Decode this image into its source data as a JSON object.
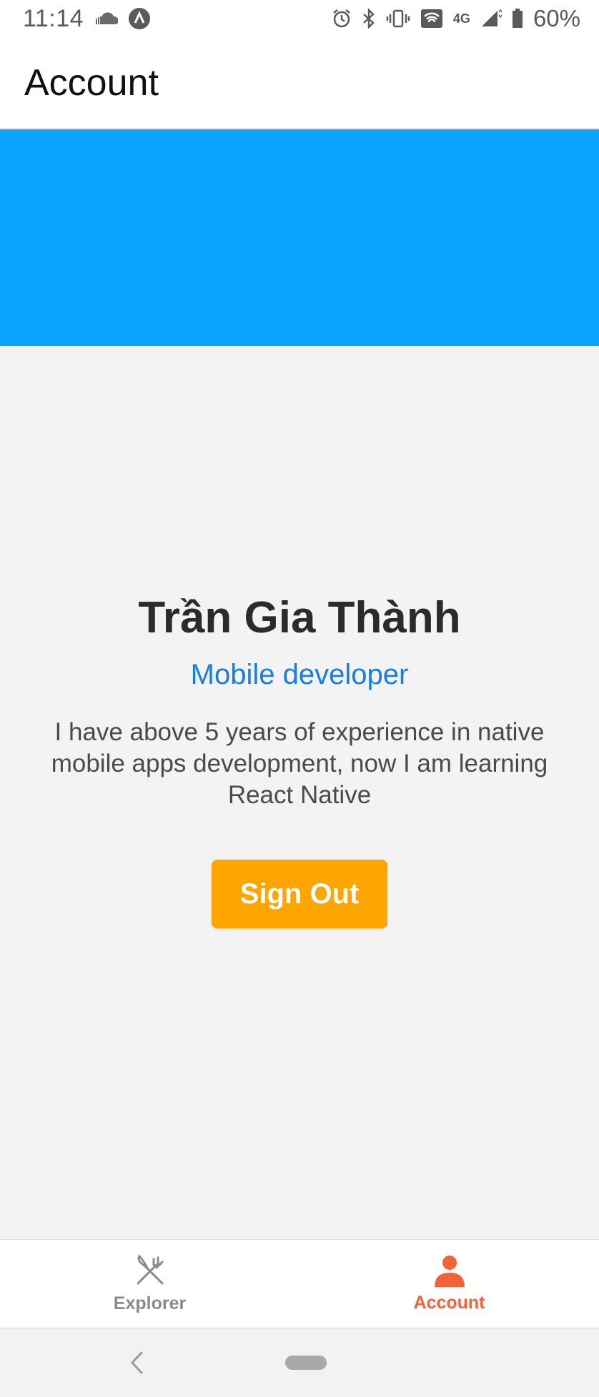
{
  "status_bar": {
    "time": "11:14",
    "network": "4G",
    "battery": "60%",
    "icons": [
      "cloud-icon",
      "app-notification-icon",
      "alarm-icon",
      "bluetooth-icon",
      "vibrate-icon",
      "wifi-icon",
      "signal-icon",
      "battery-icon"
    ]
  },
  "header": {
    "title": "Account"
  },
  "banner": {
    "color": "#0aa6fd"
  },
  "profile": {
    "name": "Trần Gia Thành",
    "role": "Mobile developer",
    "bio": "I have above 5 years of experience in native mobile apps development, now I am learning React Native",
    "signout_label": "Sign Out",
    "signout_color": "#fea500",
    "role_color": "#1a7de0"
  },
  "tabs": [
    {
      "label": "Explorer",
      "icon": "fork-knife-icon",
      "active": false
    },
    {
      "label": "Account",
      "icon": "person-icon",
      "active": true
    }
  ],
  "colors": {
    "active_tab": "#f4623a",
    "inactive_tab": "#8a8a8a"
  }
}
